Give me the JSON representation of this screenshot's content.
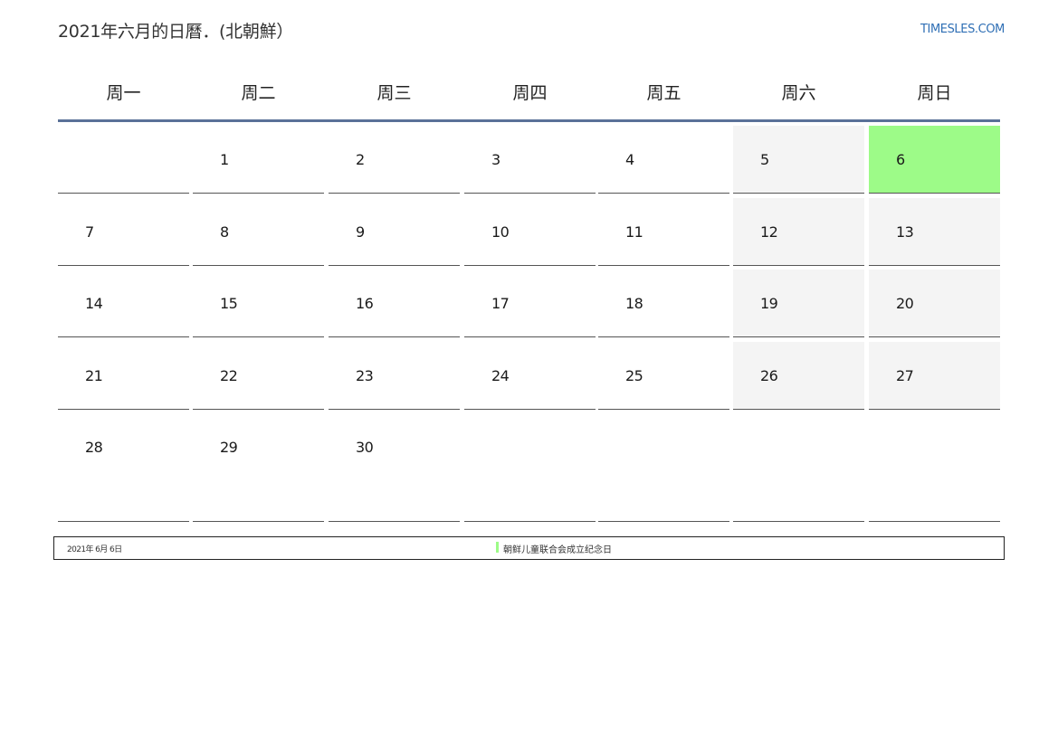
{
  "header": {
    "title": "2021年六月的日曆．(北朝鮮）",
    "site": "TIMESLES.COM"
  },
  "weekdays": [
    "周一",
    "周二",
    "周三",
    "周四",
    "周五",
    "周六",
    "周日"
  ],
  "weeks": [
    [
      "",
      "1",
      "2",
      "3",
      "4",
      "5",
      "6"
    ],
    [
      "7",
      "8",
      "9",
      "10",
      "11",
      "12",
      "13"
    ],
    [
      "14",
      "15",
      "16",
      "17",
      "18",
      "19",
      "20"
    ],
    [
      "21",
      "22",
      "23",
      "24",
      "25",
      "26",
      "27"
    ],
    [
      "28",
      "29",
      "30",
      "",
      "",
      "",
      ""
    ]
  ],
  "holidays": [
    {
      "date": "2021年 6月 6日",
      "name": "朝鲜儿童联合会成立纪念日",
      "day": "6"
    }
  ],
  "colors": {
    "holiday": "#9dfb88",
    "weekend": "#f4f4f4",
    "header_rule": "#5a7198",
    "link": "#2f6fb5"
  }
}
